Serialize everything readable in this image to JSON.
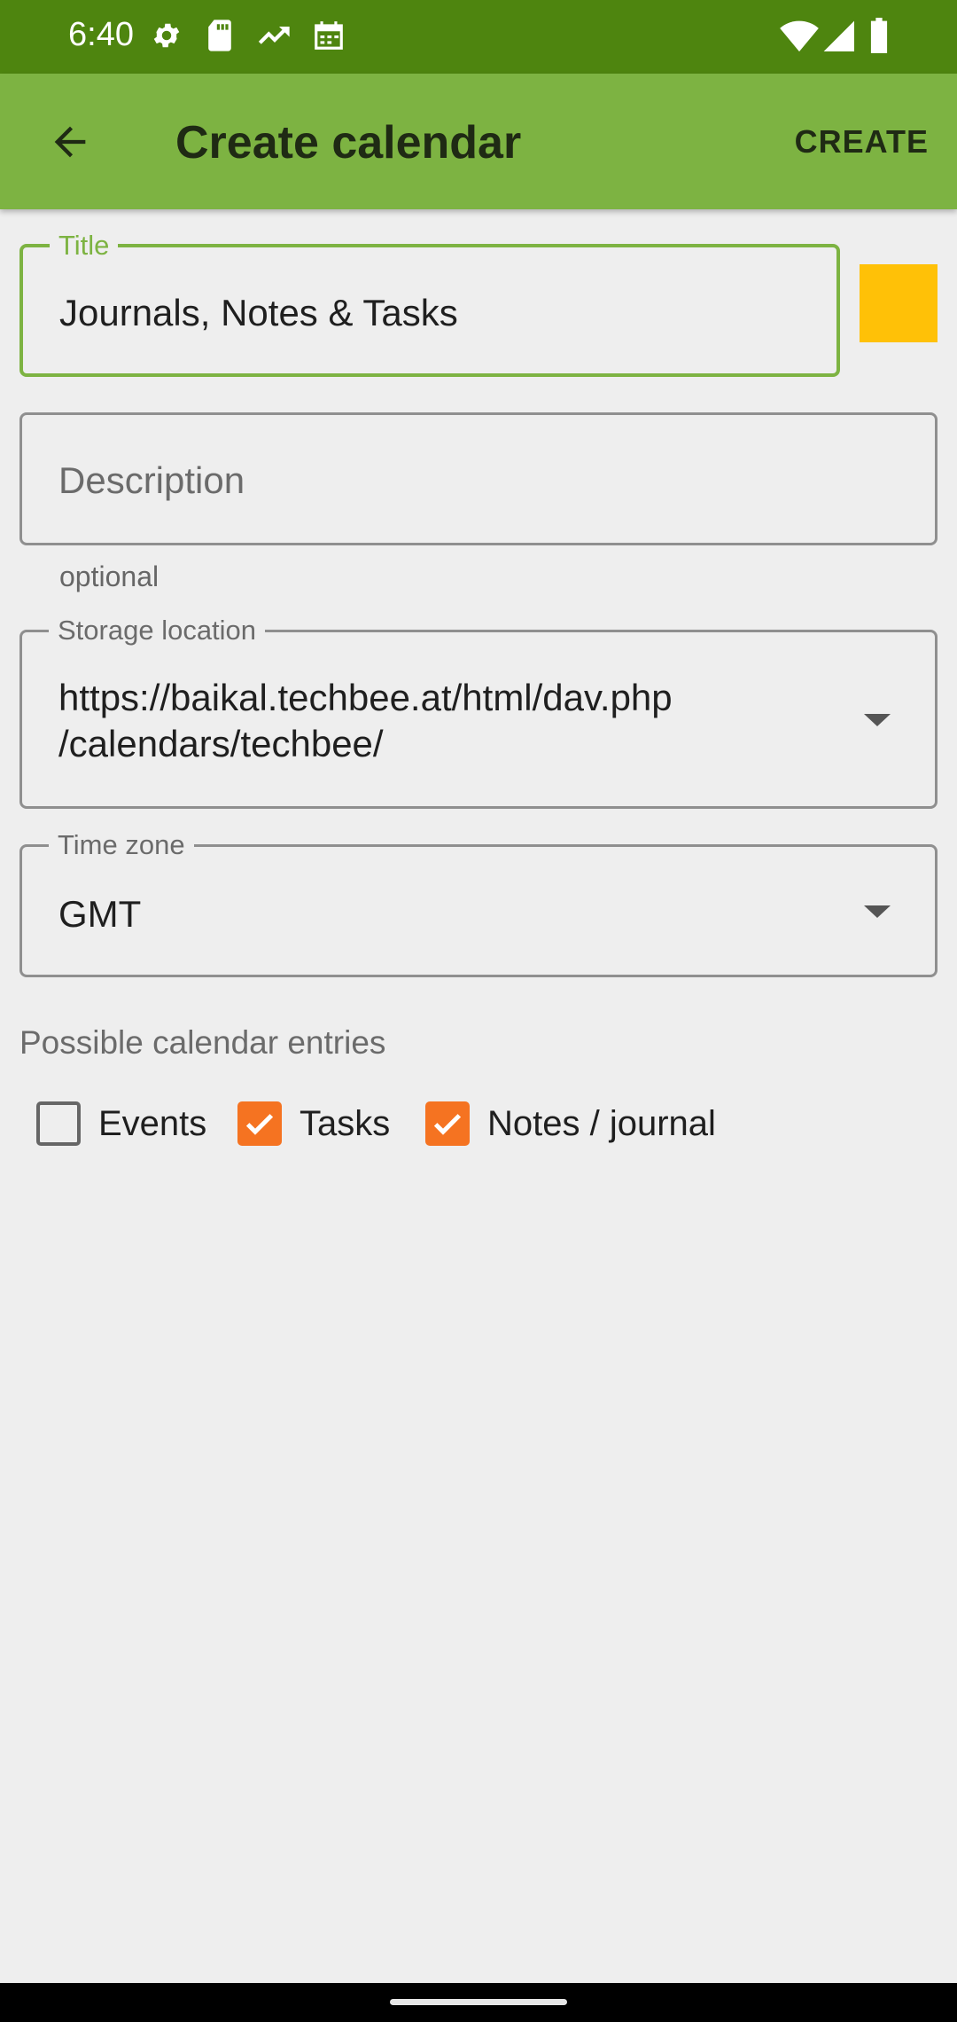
{
  "status_bar": {
    "time": "6:40",
    "icons": [
      "gear-icon",
      "sd-card-icon",
      "trending-icon",
      "calendar-icon",
      "wifi-icon",
      "signal-icon",
      "battery-icon"
    ]
  },
  "app_bar": {
    "title": "Create calendar",
    "action_label": "CREATE",
    "background": "#7db342",
    "status_background": "#4e850f"
  },
  "form": {
    "title_field": {
      "label": "Title",
      "value": "Journals, Notes & Tasks"
    },
    "color_swatch": "#ffc107",
    "description_field": {
      "placeholder": "Description",
      "helper": "optional"
    },
    "storage_field": {
      "label": "Storage location",
      "value_line1": "https://baikal.techbee.at/html/dav.php",
      "value_line2": "/calendars/techbee/"
    },
    "timezone_field": {
      "label": "Time zone",
      "value": "GMT"
    }
  },
  "entries": {
    "title": "Possible calendar entries",
    "options": [
      {
        "label": "Events",
        "checked": false
      },
      {
        "label": "Tasks",
        "checked": true
      },
      {
        "label": "Notes / journal",
        "checked": true
      }
    ],
    "accent": "#f57321"
  }
}
